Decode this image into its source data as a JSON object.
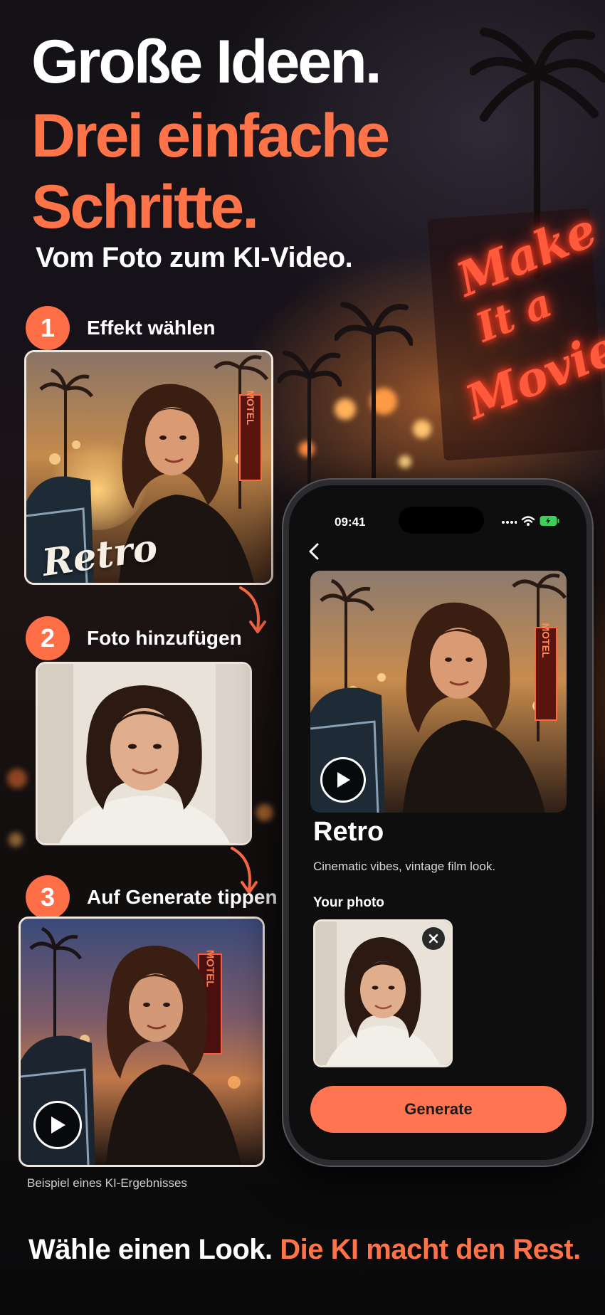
{
  "header": {
    "line1": "Große Ideen.",
    "line2": "Drei einfache",
    "line3": "Schritte.",
    "subtitle": "Vom Foto zum KI-Video."
  },
  "background": {
    "neon_sign": [
      "Make",
      "It a",
      "Movie"
    ]
  },
  "steps": [
    {
      "number": "1",
      "label": "Effekt wählen",
      "photo_overlay": "Retro",
      "motel_sign": "MOTEL"
    },
    {
      "number": "2",
      "label": "Foto hinzufügen"
    },
    {
      "number": "3",
      "label": "Auf Generate tippen",
      "motel_sign": "MOTEL"
    }
  ],
  "caption": "Beispiel eines KI-Ergebnisses",
  "phone": {
    "status_time": "09:41",
    "hero_motel_sign": "MOTEL",
    "effect_title": "Retro",
    "effect_description": "Cinematic vibes, vintage film look.",
    "your_photo_label": "Your photo",
    "remove_icon": "close-icon",
    "generate_label": "Generate"
  },
  "footer": {
    "part1": "Wähle einen Look.",
    "part2": "Die KI macht den Rest."
  },
  "colors": {
    "accent": "#ff7348",
    "button": "#ff7552",
    "background": "#0b0b0d"
  }
}
